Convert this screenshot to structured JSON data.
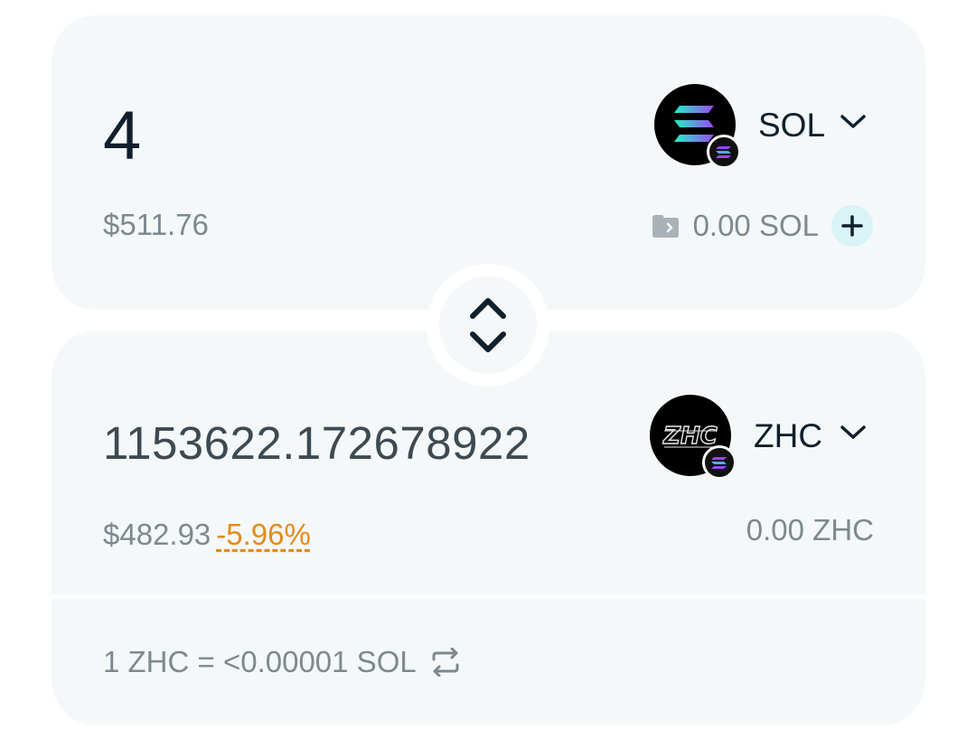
{
  "pay": {
    "amount": "4",
    "usd_value": "$511.76",
    "token_symbol": "SOL",
    "token_icon": "solana-icon",
    "balance": "0.00 SOL",
    "wallet_icon": "wallet-icon",
    "add_icon": "plus-icon"
  },
  "swap_direction_icon": "swap-vertical-icon",
  "receive": {
    "amount": "1153622.172678922",
    "usd_value": "$482.93",
    "price_change": "-5.96%",
    "token_symbol": "ZHC",
    "token_icon": "zhc-icon",
    "balance": "0.00 ZHC"
  },
  "rate": {
    "text": "1 ZHC = <0.00001 SOL",
    "toggle_icon": "swap-horizontal-icon"
  },
  "colors": {
    "card_bg": "#f4f8f9",
    "text_primary": "#0f1f2b",
    "text_muted": "#7e898f",
    "warning": "#e8891b",
    "add_button_bg": "#d9f3f7"
  }
}
